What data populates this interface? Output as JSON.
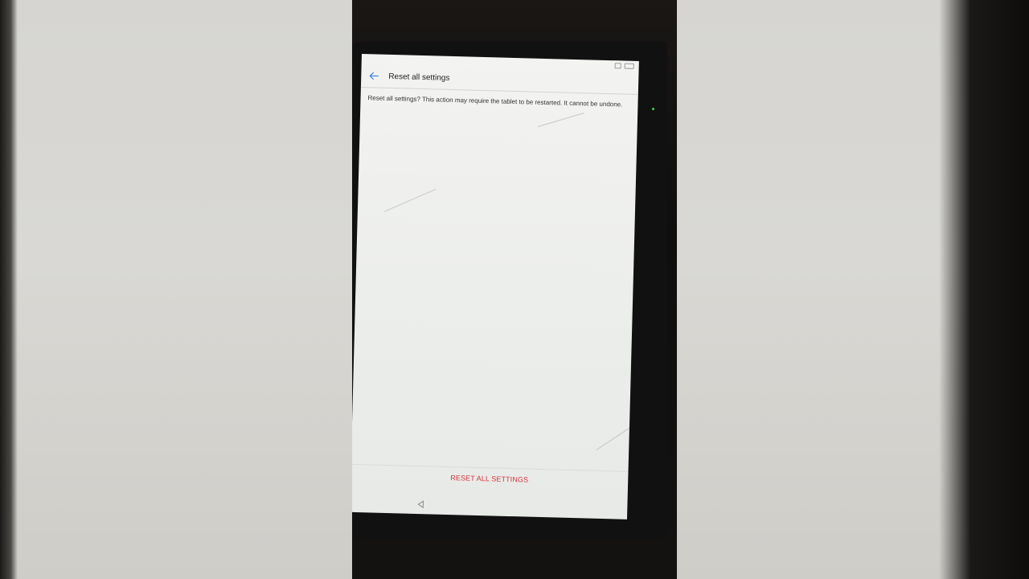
{
  "screen": {
    "title": "Reset all settings",
    "description": "Reset all settings? This action may require the tablet to be restarted. It cannot be undone.",
    "action_button": "RESET ALL SETTINGS"
  },
  "icons": {
    "back": "arrow-left-icon",
    "nav_back": "triangle-left-icon",
    "status": [
      "notification-icon",
      "battery-icon"
    ]
  },
  "colors": {
    "accent_blue": "#3b82d6",
    "action_red": "#d6333a",
    "screen_bg": "#eeeeec"
  }
}
